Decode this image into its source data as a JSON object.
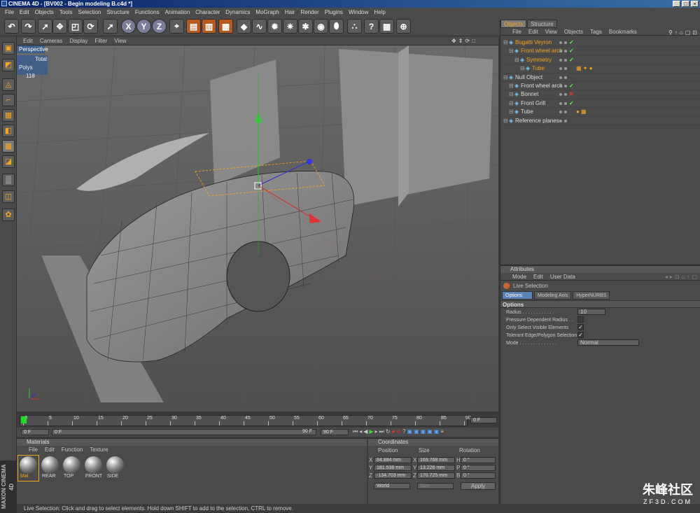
{
  "app": {
    "title": "CINEMA 4D - [BV002 - Begin modeling B.c4d *]"
  },
  "menu": [
    "File",
    "Edit",
    "Objects",
    "Tools",
    "Selection",
    "Structure",
    "Functions",
    "Animation",
    "Character",
    "Dynamics",
    "MoGraph",
    "Hair",
    "Render",
    "Plugins",
    "Window",
    "Help"
  ],
  "toolbar": {
    "icons": [
      "undo-icon",
      "redo-icon",
      "live-selection-icon",
      "move-icon",
      "scale-icon",
      "rotate-icon",
      "recent-tool-icon",
      "x-axis-icon",
      "y-axis-icon",
      "z-axis-icon",
      "coordinate-system-icon",
      "render-view-icon",
      "render-picture-viewer-icon",
      "render-settings-icon",
      "cube-primitive-icon",
      "spline-pen-icon",
      "nurbs-icon",
      "array-icon",
      "deformer-icon",
      "scene-icon",
      "light-icon",
      "camera-icon",
      "help-icon",
      "layout-icon",
      "web-icon"
    ],
    "axis_labels": [
      "X",
      "Y",
      "Z"
    ]
  },
  "viewport": {
    "menu": [
      "Edit",
      "Cameras",
      "Display",
      "Filter",
      "View"
    ],
    "label": "Perspective",
    "stats": {
      "total_label": "Total",
      "polys_label": "Polys",
      "polys_value": "118"
    }
  },
  "timeline": {
    "ticks": [
      "0",
      "5",
      "10",
      "15",
      "20",
      "25",
      "30",
      "35",
      "40",
      "45",
      "50",
      "55",
      "60",
      "65",
      "70",
      "75",
      "80",
      "85",
      "90"
    ],
    "current": "0 F",
    "start": "0 F",
    "min": "0 F",
    "max": "90 F",
    "end": "90 F"
  },
  "materials": {
    "title": "Materials",
    "menu": [
      "File",
      "Edit",
      "Function",
      "Texture"
    ],
    "items": [
      "Mat",
      "REAR",
      "TOP",
      "FRONT",
      "SIDE"
    ]
  },
  "coordinates": {
    "title": "Coordinates",
    "headers": [
      "Position",
      "Size",
      "Rotation"
    ],
    "rows": [
      {
        "axis": "X",
        "pos": "84.884 mm",
        "size_axis": "X",
        "size": "169.768 mm",
        "rot_axis": "H",
        "rot": "0 °"
      },
      {
        "axis": "Y",
        "pos": "181.538 mm",
        "size_axis": "Y",
        "size": "13.226 mm",
        "rot_axis": "P",
        "rot": "0 °"
      },
      {
        "axis": "Z",
        "pos": "-134.703 mm",
        "size_axis": "Z",
        "size": "170.725 mm",
        "rot_axis": "B",
        "rot": "0 °"
      }
    ],
    "mode": "World",
    "size_mode": "Size",
    "apply_label": "Apply"
  },
  "objects": {
    "tabs": [
      "Objects",
      "Structure"
    ],
    "menu": [
      "File",
      "Edit",
      "View",
      "Objects",
      "Tags",
      "Bookmarks"
    ],
    "tree": [
      {
        "name": "Bugatti Veyron",
        "indent": 0,
        "color": "#f4a51c",
        "chk": "✓",
        "tags": ""
      },
      {
        "name": "Front wheel arch",
        "indent": 1,
        "color": "#f4a51c",
        "chk": "✓",
        "tags": ""
      },
      {
        "name": "Symmetry",
        "indent": 2,
        "color": "#f4a51c",
        "chk": "✓",
        "tags": ""
      },
      {
        "name": "Tube",
        "indent": 3,
        "color": "#f4a51c",
        "chk": "",
        "tags": "▦ ✦ ●"
      },
      {
        "name": "Null Object",
        "indent": 0,
        "color": "#ddd",
        "chk": "",
        "tags": ""
      },
      {
        "name": "Front wheel arch",
        "indent": 1,
        "color": "#ddd",
        "chk": "✓",
        "tags": ""
      },
      {
        "name": "Bonnet",
        "indent": 1,
        "color": "#ddd",
        "chk": "✕",
        "tags": ""
      },
      {
        "name": "Front Grill",
        "indent": 1,
        "color": "#ddd",
        "chk": "✓",
        "tags": ""
      },
      {
        "name": "Tube",
        "indent": 1,
        "color": "#ddd",
        "chk": "",
        "tags": "● ▦"
      },
      {
        "name": "Reference planes",
        "indent": 0,
        "color": "#ddd",
        "chk": "",
        "tags": ""
      }
    ]
  },
  "attributes": {
    "title": "Attributes",
    "menu": [
      "Mode",
      "Edit",
      "User Data"
    ],
    "tool_name": "Live Selection",
    "tabs": [
      "Options",
      "Modeling Axis",
      "HyperNURBS"
    ],
    "section": "Options",
    "fields": [
      {
        "label": "Radius . . . . . . . . . . . .",
        "value": "10"
      },
      {
        "label": "Pressure Dependent Radius . .",
        "value": ""
      },
      {
        "label": "Only Select Visible Elements",
        "value": "✓"
      },
      {
        "label": "Tolerant Edge/Polygon Selection",
        "value": "✓"
      },
      {
        "label": "Mode . . . . . . . . . . . . . .",
        "value": "Normal"
      }
    ]
  },
  "status": "Live Selection: Click and drag to select elements. Hold down SHIFT to add to the selection, CTRL to remove.",
  "branding": {
    "logo": "MAXON CINEMA 4D",
    "watermark_big": "朱峰社区",
    "watermark_small": "ZF3D.COM"
  }
}
